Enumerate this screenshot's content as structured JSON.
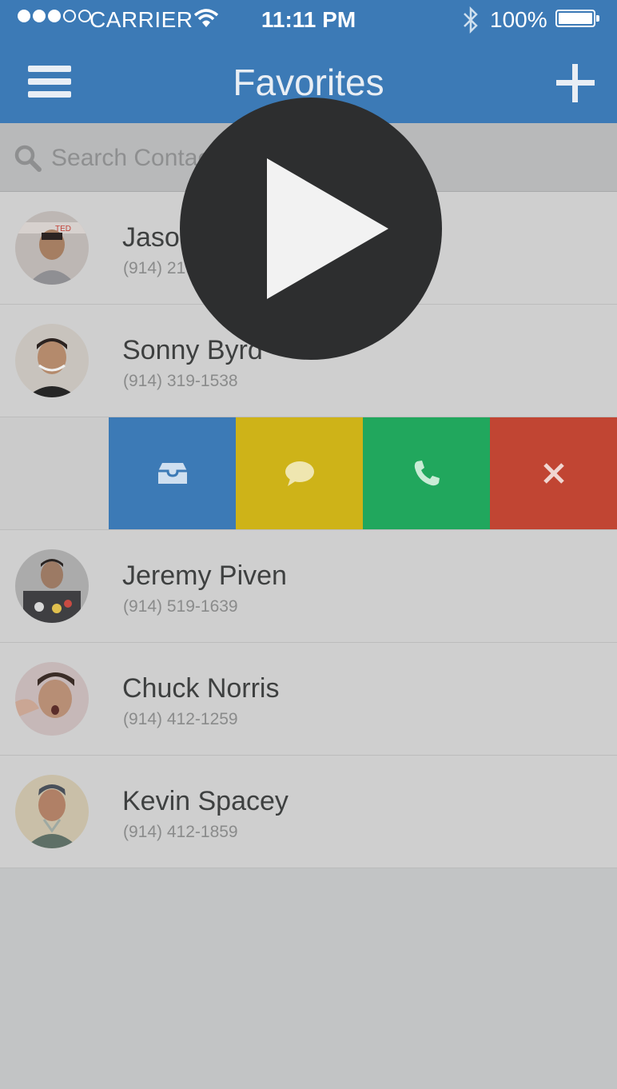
{
  "status_bar": {
    "carrier": "CARRIER",
    "time": "11:11 PM",
    "battery": "100%",
    "signal_bars_filled": 3,
    "signal_bars_total": 5
  },
  "nav": {
    "title": "Favorites",
    "menu_icon": "hamburger-icon",
    "add_icon": "plus-icon"
  },
  "search": {
    "placeholder": "Search Contacts",
    "value": ""
  },
  "contacts": [
    {
      "name": "Jason Novak",
      "phone": "(914) 219-1439"
    },
    {
      "name": "Sonny Byrd",
      "phone": "(914) 319-1538"
    },
    {
      "name": "Jeremy Piven",
      "phone": "(914) 519-1639"
    },
    {
      "name": "Chuck Norris",
      "phone": "(914) 412-1259"
    },
    {
      "name": "Kevin Spacey",
      "phone": "(914) 412-1859"
    }
  ],
  "swipe_actions": [
    {
      "icon": "archive-icon",
      "color": "#3c7ab6"
    },
    {
      "icon": "message-icon",
      "color": "#ceb318"
    },
    {
      "icon": "phone-icon",
      "color": "#21a75d"
    },
    {
      "icon": "close-icon",
      "color": "#c14533"
    }
  ],
  "colors": {
    "primary": "#3c7ab6",
    "overlay_play": "#2d2e2f"
  },
  "overlay": {
    "icon": "play-icon"
  }
}
